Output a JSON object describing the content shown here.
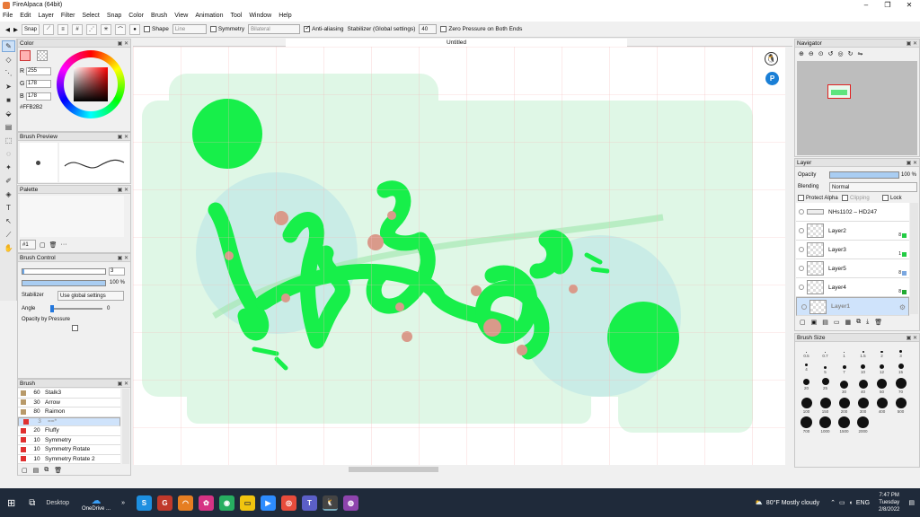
{
  "window": {
    "title": "FireAlpaca (64bit)",
    "controls": [
      "–",
      "❐",
      "✕"
    ]
  },
  "menu": [
    "File",
    "Edit",
    "Layer",
    "Filter",
    "Select",
    "Snap",
    "Color",
    "Brush",
    "View",
    "Animation",
    "Tool",
    "Window",
    "Help"
  ],
  "toolbar": {
    "prev": "◀",
    "next": "▶",
    "snap_label": "Snap",
    "shape_label": "Shape",
    "shape_value": "Line",
    "symmetry_label": "Symmetry",
    "symmetry_value": "Bilateral",
    "antialias_label": "Anti-aliasing",
    "stabilizer_label": "Stabilizer (Global settings)",
    "stabilizer_value": "40",
    "zero_pressure_label": "Zero Pressure on Both Ends"
  },
  "canvas": {
    "tab": "Untitled"
  },
  "color_panel": {
    "title": "Color",
    "r_label": "R",
    "r": "255",
    "g_label": "G",
    "g": "178",
    "b_label": "B",
    "b": "178",
    "hex": "#FFB2B2",
    "fg_color": "#ffb2b2"
  },
  "brush_preview": {
    "title": "Brush Preview"
  },
  "palette": {
    "title": "Palette",
    "index": "#1"
  },
  "brush_control": {
    "title": "Brush Control",
    "size": "3",
    "opacity": "100 %",
    "stabilizer_label": "Stabilizer",
    "stabilizer_value": "Use global settings",
    "angle_label": "Angle",
    "angle_value": "0",
    "opacity_pressure_label": "Opacity by Pressure"
  },
  "brush_list": {
    "title": "Brush",
    "items": [
      {
        "size": "60",
        "name": "Stalk3",
        "color": "#b89a6a"
      },
      {
        "size": "30",
        "name": "Arrow",
        "color": "#b89a6a"
      },
      {
        "size": "80",
        "name": "Raimon",
        "color": "#b89a6a"
      },
      {
        "size": "3",
        "name": "==*",
        "color": "#e03030",
        "selected": true
      },
      {
        "size": "20",
        "name": "Fluffy",
        "color": "#e03030"
      },
      {
        "size": "10",
        "name": "Symmetry",
        "color": "#e03030"
      },
      {
        "size": "10",
        "name": "Symmetry Rotate",
        "color": "#e03030"
      },
      {
        "size": "10",
        "name": "Symmetry Rotate 2",
        "color": "#e03030"
      }
    ]
  },
  "navigator": {
    "title": "Navigator"
  },
  "layer_panel": {
    "title": "Layer",
    "opacity_label": "Opacity",
    "opacity_value": "100 %",
    "blending_label": "Blending",
    "blending_value": "Normal",
    "protect_alpha": "Protect Alpha",
    "clipping": "Clipping",
    "lock": "Lock",
    "layers": [
      {
        "name": "NHs1102 – HD247",
        "folder": true
      },
      {
        "name": "Layer2",
        "num": "8",
        "color": "#22cc44"
      },
      {
        "name": "Layer3",
        "num": "1",
        "color": "#22cc44"
      },
      {
        "name": "Layer5",
        "num": "8",
        "color": "#7aa7e0"
      },
      {
        "name": "Layer4",
        "num": "8",
        "color": "#22aa33"
      },
      {
        "name": "Layer1",
        "selected": true
      }
    ]
  },
  "brush_size": {
    "title": "Brush Size",
    "sizes": [
      "0.5",
      "0.7",
      "1",
      "1.5",
      "2",
      "3",
      "4",
      "5",
      "7",
      "10",
      "12",
      "15",
      "20",
      "25",
      "30",
      "40",
      "50",
      "70",
      "100",
      "150",
      "200",
      "300",
      "400",
      "500",
      "700",
      "1000",
      "1500",
      "2000"
    ]
  },
  "taskbar": {
    "desktop": "Desktop",
    "onedrive": "OneDrive ...",
    "weather": "80°F  Mostly cloudy",
    "lang": "ENG",
    "time": "7:47 PM",
    "day": "Tuesday",
    "date": "2/8/2022"
  }
}
